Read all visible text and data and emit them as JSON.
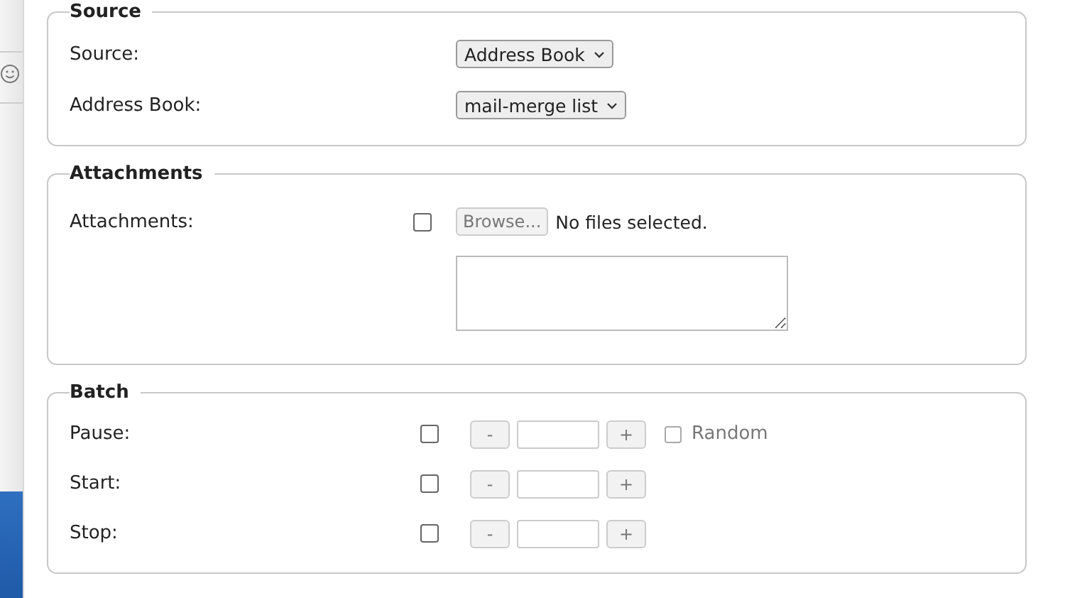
{
  "sections": [
    {
      "title": "Source",
      "rows": [
        {
          "kind": "select",
          "label": "Source:",
          "value": "Address Book"
        },
        {
          "kind": "select",
          "label": "Address Book:",
          "value": "mail-merge list"
        }
      ]
    },
    {
      "title": "Attachments",
      "rows": [
        {
          "kind": "file",
          "label": "Attachments:",
          "checked": false,
          "button": "Browse...",
          "disabled": true,
          "status": "No files selected."
        },
        {
          "kind": "textarea"
        }
      ]
    },
    {
      "title": "Batch",
      "rows": [
        {
          "kind": "stepper",
          "label": "Pause:",
          "checked": false,
          "minus": "-",
          "plus": "+",
          "disabled": true,
          "option": {
            "label": "Random",
            "checked": false,
            "disabled": true
          }
        },
        {
          "kind": "stepper",
          "label": "Start:",
          "checked": false,
          "minus": "-",
          "plus": "+",
          "disabled": true
        },
        {
          "kind": "stepper",
          "label": "Stop:",
          "checked": false,
          "minus": "-",
          "plus": "+",
          "disabled": true
        }
      ]
    }
  ]
}
